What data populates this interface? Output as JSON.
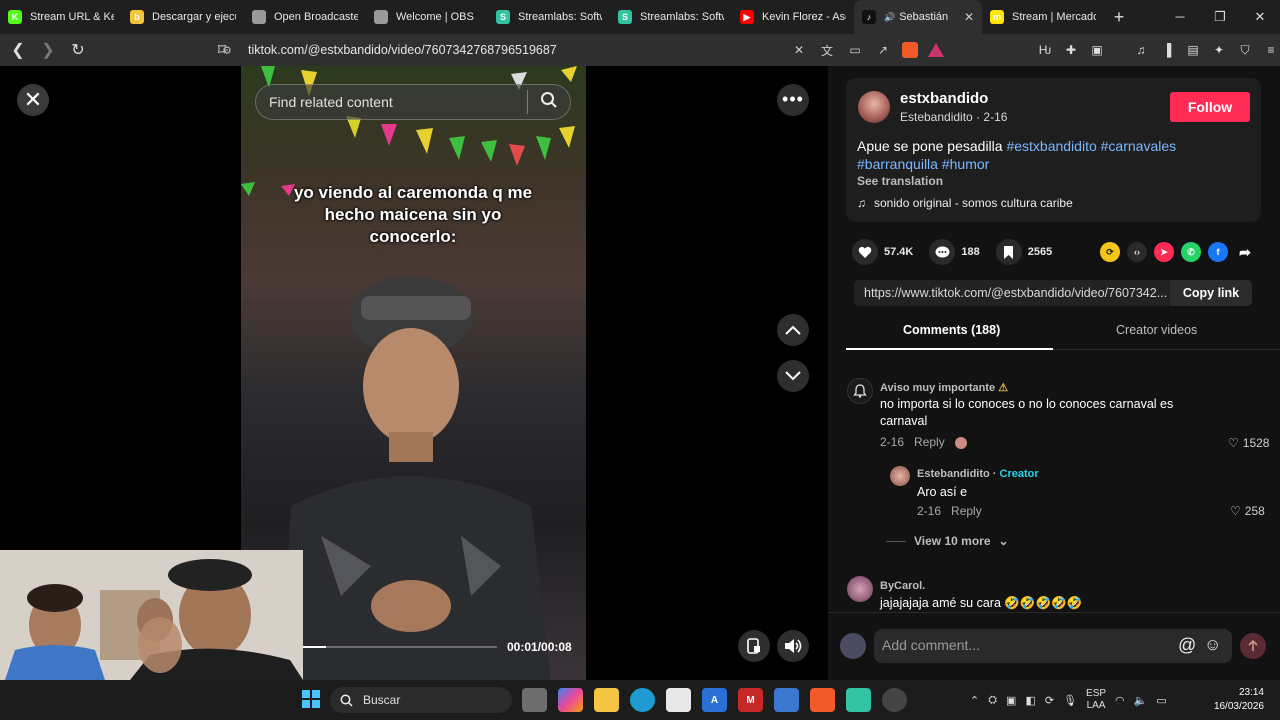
{
  "browser": {
    "tabs": [
      {
        "title": "Stream URL & Key",
        "icon": "kick-icon",
        "color": "#53fc18",
        "letter": "K"
      },
      {
        "title": "Descargar y ejecu",
        "icon": "app-icon",
        "color": "#f2c53d",
        "letter": "b"
      },
      {
        "title": "Open Broadcaster",
        "icon": "obs-icon",
        "color": "#9a9a9a",
        "letter": ""
      },
      {
        "title": "Welcome | OBS",
        "icon": "globe-icon",
        "color": "#9a9a9a",
        "letter": ""
      },
      {
        "title": "Streamlabs: Softw",
        "icon": "streamlabs-icon",
        "color": "#31c3a2",
        "letter": "S"
      },
      {
        "title": "Streamlabs: Softw",
        "icon": "streamlabs-icon",
        "color": "#31c3a2",
        "letter": "S"
      },
      {
        "title": "Kevin Florez - Aso",
        "icon": "youtube-icon",
        "color": "#ff0000",
        "letter": "▶"
      },
      {
        "title": "Sebastián",
        "icon": "tiktok-icon",
        "color": "#111111",
        "letter": "♪",
        "active": true
      },
      {
        "title": "Stream | Mercadol",
        "icon": "mercadolibre-icon",
        "color": "#ffe600",
        "letter": "m"
      }
    ],
    "new_tab": "+",
    "url": "tiktok.com/@estxbandido/video/7607342768796519687"
  },
  "video": {
    "search_placeholder": "Find related content",
    "caption": "yo viendo al caremonda q me hecho maicena sin yo conocerlo:",
    "time": "00:01/00:08",
    "progress": 0.125
  },
  "post": {
    "username": "estxbandido",
    "display_name": "Estebandidito",
    "date": "2-16",
    "follow_label": "Follow",
    "description_text": "Apue se pone pesadilla ",
    "hashtags": [
      "#estxbandidito",
      "#carnavales",
      "#barranquilla",
      "#humor"
    ],
    "see_translation": "See translation",
    "music": "sonido original - somos cultura caribe",
    "likes": "57.4K",
    "comments_count": "188",
    "saves": "2565",
    "link": "https://www.tiktok.com/@estxbandido/video/7607342...",
    "copy_link_label": "Copy link",
    "tab_comments": "Comments (188)",
    "tab_creator": "Creator videos"
  },
  "comments": [
    {
      "user": "Aviso muy importante",
      "badge": "⚠",
      "text": "no importa si lo conoces o no lo conoces carnaval es carnaval",
      "date": "2-16",
      "reply": "Reply",
      "likes": "1528"
    },
    {
      "user": "Estebandidito",
      "creator_tag": "Creator",
      "text": "Aro así e",
      "date": "2-16",
      "reply": "Reply",
      "likes": "258"
    },
    {
      "user": "ByCarol.",
      "text": "jajajajaja amé su cara 🤣🤣🤣🤣🤣"
    }
  ],
  "view_more": "View 10 more",
  "comment_input_placeholder": "Add comment...",
  "taskbar": {
    "search_label": "Buscar",
    "lang_line1": "ESP",
    "lang_line2": "LAA",
    "time": "23:14",
    "date": "16/03/2026"
  }
}
